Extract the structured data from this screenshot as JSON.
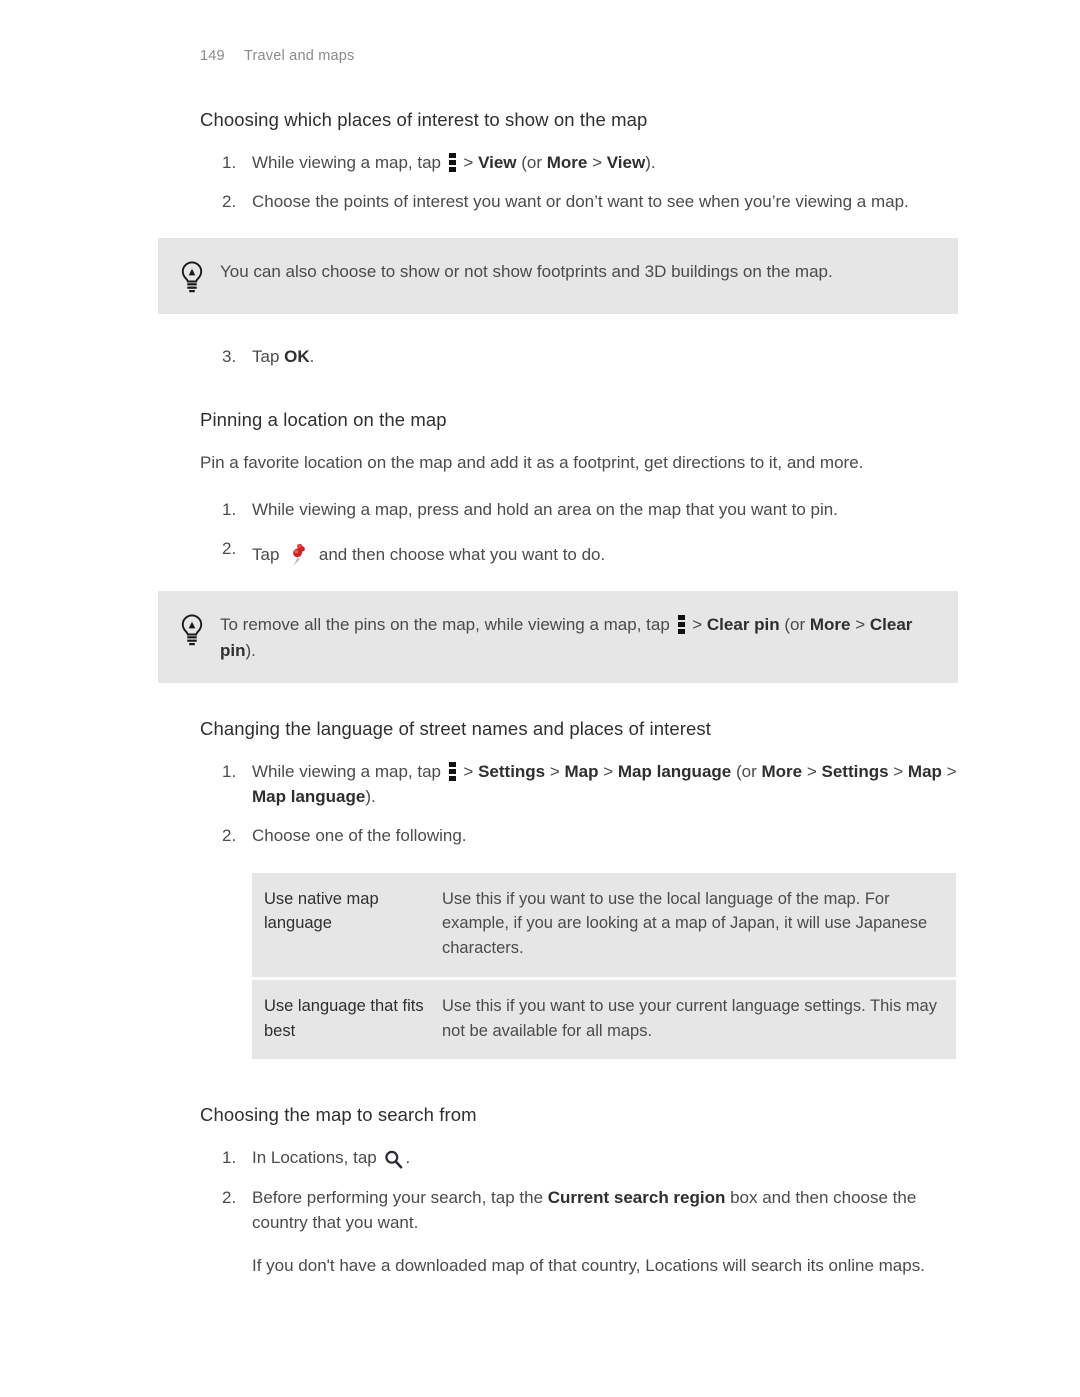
{
  "header": {
    "page_number": "149",
    "chapter": "Travel and maps"
  },
  "icons": {
    "overflow": "overflow-menu-icon",
    "bulb": "lightbulb-icon",
    "pin": "pushpin-icon",
    "search": "search-icon"
  },
  "sections": [
    {
      "id": "choosing-places-of-interest",
      "heading": "Choosing which places of interest to show on the map",
      "steps": [
        {
          "marker": "1.",
          "parts": [
            {
              "t": "text",
              "v": "While viewing a map, tap "
            },
            {
              "t": "icon",
              "v": "overflow-menu-icon"
            },
            {
              "t": "text",
              "v": " > "
            },
            {
              "t": "bold",
              "v": "View"
            },
            {
              "t": "text",
              "v": " (or "
            },
            {
              "t": "bold",
              "v": "More"
            },
            {
              "t": "text",
              "v": " > "
            },
            {
              "t": "bold",
              "v": "View"
            },
            {
              "t": "text",
              "v": ")."
            }
          ]
        },
        {
          "marker": "2.",
          "parts": [
            {
              "t": "text",
              "v": "Choose the points of interest you want or don’t want to see when you’re viewing a map."
            }
          ]
        }
      ],
      "callout": {
        "icon": "lightbulb-icon",
        "text": "You can also choose to show or not show footprints and 3D buildings on the map."
      },
      "steps_after": [
        {
          "marker": "3.",
          "parts": [
            {
              "t": "text",
              "v": "Tap "
            },
            {
              "t": "bold",
              "v": "OK"
            },
            {
              "t": "text",
              "v": "."
            }
          ]
        }
      ]
    },
    {
      "id": "pinning-a-location",
      "heading": "Pinning a location on the map",
      "intro": "Pin a favorite location on the map and add it as a footprint, get directions to it, and more.",
      "steps": [
        {
          "marker": "1.",
          "parts": [
            {
              "t": "text",
              "v": "While viewing a map, press and hold an area on the map that you want to pin."
            }
          ]
        },
        {
          "marker": "2.",
          "parts": [
            {
              "t": "text",
              "v": "Tap "
            },
            {
              "t": "icon",
              "v": "pushpin-icon"
            },
            {
              "t": "text",
              "v": " and then choose what you want to do."
            }
          ]
        }
      ],
      "callout": {
        "icon": "lightbulb-icon",
        "parts": [
          {
            "t": "text",
            "v": "To remove all the pins on the map, while viewing a map, tap "
          },
          {
            "t": "icon",
            "v": "overflow-menu-icon"
          },
          {
            "t": "text",
            "v": " > "
          },
          {
            "t": "bold",
            "v": "Clear pin"
          },
          {
            "t": "text",
            "v": " (or "
          },
          {
            "t": "bold",
            "v": "More"
          },
          {
            "t": "text",
            "v": " > "
          },
          {
            "t": "bold",
            "v": "Clear pin"
          },
          {
            "t": "text",
            "v": ")."
          }
        ]
      }
    },
    {
      "id": "changing-the-language",
      "heading": "Changing the language of street names and places of interest",
      "steps": [
        {
          "marker": "1.",
          "parts": [
            {
              "t": "text",
              "v": "While viewing a map, tap "
            },
            {
              "t": "icon",
              "v": "overflow-menu-icon"
            },
            {
              "t": "text",
              "v": " > "
            },
            {
              "t": "bold",
              "v": "Settings"
            },
            {
              "t": "text",
              "v": " > "
            },
            {
              "t": "bold",
              "v": "Map"
            },
            {
              "t": "text",
              "v": " > "
            },
            {
              "t": "bold",
              "v": "Map language"
            },
            {
              "t": "text",
              "v": " (or "
            },
            {
              "t": "bold",
              "v": "More"
            },
            {
              "t": "text",
              "v": " > "
            },
            {
              "t": "bold",
              "v": "Settings"
            },
            {
              "t": "text",
              "v": " > "
            },
            {
              "t": "bold",
              "v": "Map"
            },
            {
              "t": "text",
              "v": " > "
            },
            {
              "t": "bold",
              "v": "Map language"
            },
            {
              "t": "text",
              "v": ")."
            }
          ]
        },
        {
          "marker": "2.",
          "parts": [
            {
              "t": "text",
              "v": "Choose one of the following."
            }
          ]
        }
      ],
      "table": {
        "rows": [
          {
            "term": "Use native map language",
            "desc": "Use this if you want to use the local language of the map. For example, if you are looking at a map of Japan, it will use Japanese characters."
          },
          {
            "term": "Use language that fits best",
            "desc": "Use this if you want to use your current language settings. This may not be available for all maps."
          }
        ]
      }
    },
    {
      "id": "choosing-the-map-to-search-from",
      "heading": "Choosing the map to search from",
      "steps": [
        {
          "marker": "1.",
          "parts": [
            {
              "t": "text",
              "v": "In Locations, tap "
            },
            {
              "t": "icon",
              "v": "search-icon"
            },
            {
              "t": "text",
              "v": "."
            }
          ]
        },
        {
          "marker": "2.",
          "parts": [
            {
              "t": "text",
              "v": "Before performing your search, tap the "
            },
            {
              "t": "bold",
              "v": "Current search region"
            },
            {
              "t": "text",
              "v": " box and then choose the country that you want."
            }
          ],
          "sub_para": "If you don't have a downloaded map of that country, Locations will search its online maps."
        }
      ]
    }
  ],
  "colors": {
    "callout_background": "#e6e6e6",
    "table_background": "#e6e6e6",
    "body_text": "#4b4b4b",
    "heading_text": "#2f2f2f",
    "header_text": "#8a8a8a",
    "page_background": "#ffffff"
  }
}
